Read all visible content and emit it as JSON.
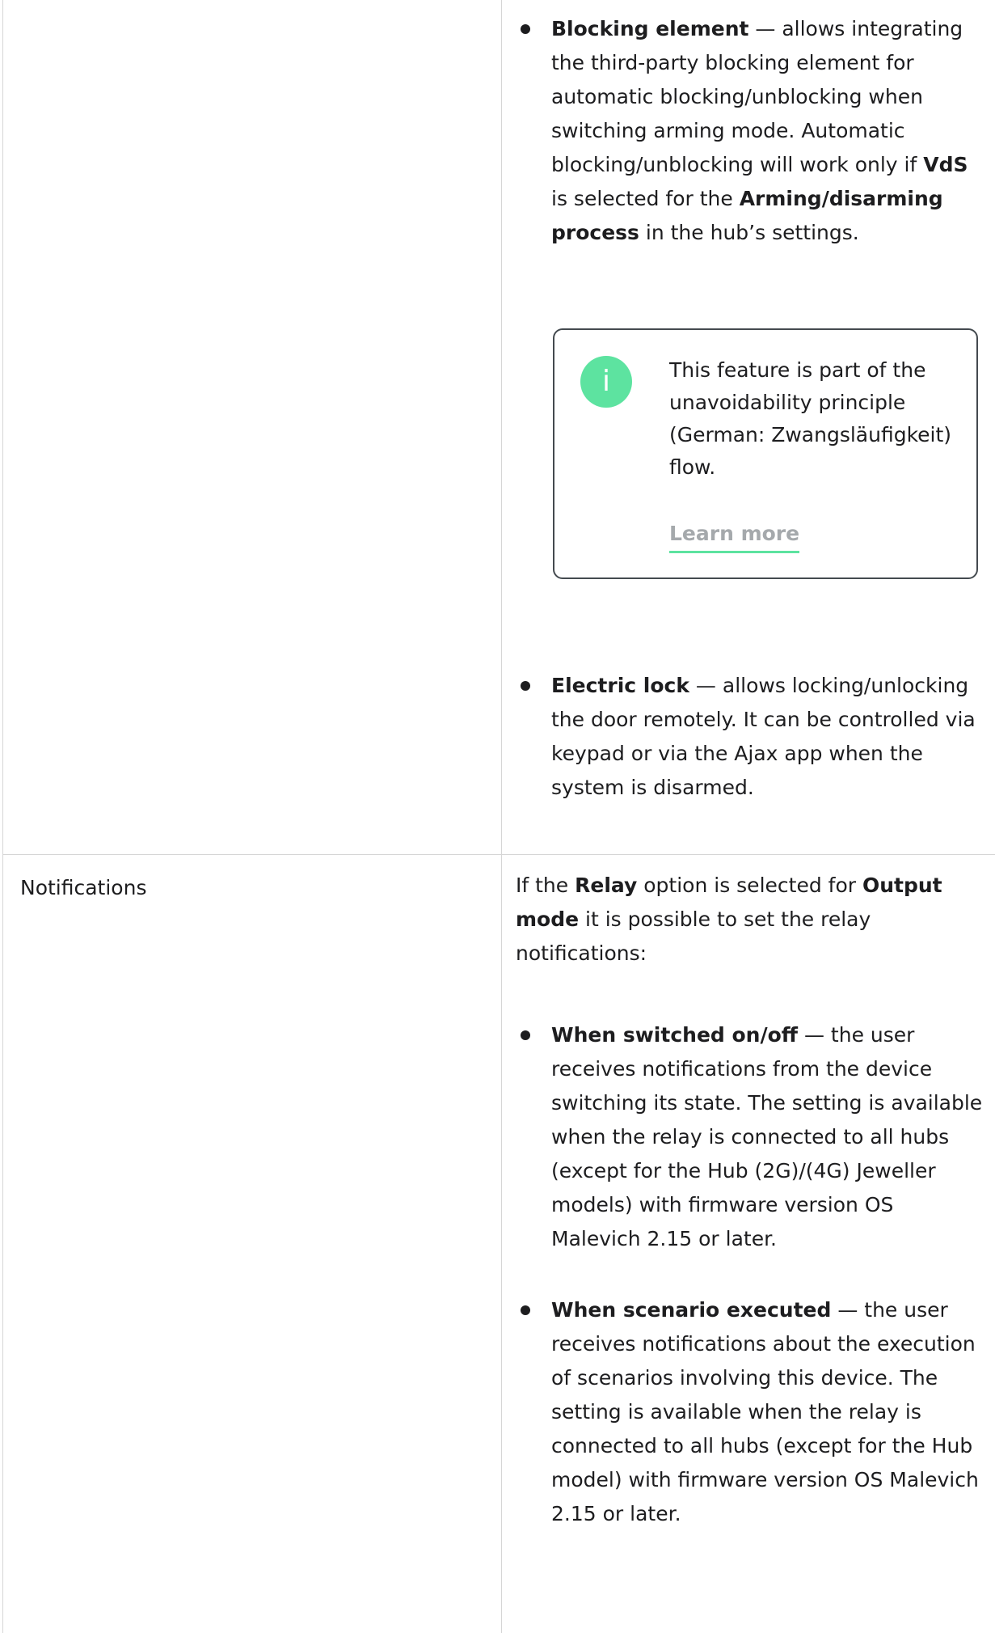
{
  "blocking": {
    "title": "Blocking element",
    "t1": " — allows integrating the third-party blocking element for automatic blocking/unblocking when switching arming mode. Automatic blocking/unblocking will work only if ",
    "vds": "VdS",
    "t2": " is selected for the ",
    "arming": "Arming/disarming process",
    "t3": " in the hub’s settings."
  },
  "note": {
    "icon": "info-icon",
    "text": "This feature is part of the unavoidability principle (German: Zwangsläufigkeit) flow.",
    "link": "Learn more"
  },
  "electric_lock": {
    "title": "Electric lock",
    "text": " — allows locking/unlocking the door remotely. It can be controlled via keypad or via the Ajax app when the system is disarmed."
  },
  "notifications": {
    "label": "Notifications",
    "i1": "If the ",
    "relay": "Relay",
    "i2": " option is selected for ",
    "output_mode": "Output mode",
    "i3": " it is possible to set the relay notifications:",
    "switched_title": "When switched on/off",
    "switched_text": " — the user receives notifications from the device switching its state. The setting is available when the relay is connected to all hubs (except for the Hub (2G)/(4G) Jeweller models) with firmware version OS Malevich 2.15 or later.",
    "scenario_title": "When scenario executed",
    "scenario_text": " — the user receives notifications about the execution of scenarios involving this device. The setting is available when the relay is connected to all hubs (except for the Hub model) with firmware version OS Malevich 2.15 or later."
  },
  "colors": {
    "accent": "#5de3a0",
    "text": "#1d1d1f",
    "border": "#d6d6d6",
    "link": "#a5a9ac"
  }
}
